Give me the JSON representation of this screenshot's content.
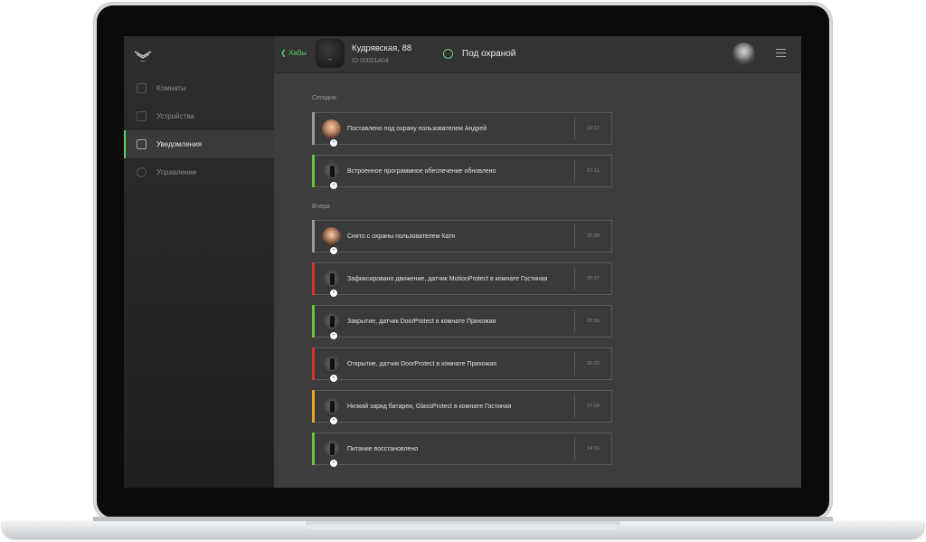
{
  "sidebar": {
    "items": [
      {
        "label": "Комнаты",
        "icon": "rooms-icon",
        "active": false
      },
      {
        "label": "Устройства",
        "icon": "devices-icon",
        "active": false
      },
      {
        "label": "Уведомления",
        "icon": "notifications-icon",
        "active": true
      },
      {
        "label": "Управление",
        "icon": "control-icon",
        "active": false
      }
    ]
  },
  "header": {
    "back_label": "Хабы",
    "hub_name": "Кудрявская, 88",
    "hub_id": "ID 00001A04",
    "status": "Под охраной"
  },
  "sections": {
    "today": "Сегодня",
    "yesterday": "Вчера"
  },
  "events": [
    {
      "text": "Поставлено под охрану пользователем Андрей",
      "time": "10:17",
      "accent": "#9a9a9a",
      "icon": "user-avatar-icon"
    },
    {
      "text": "Встроенное программное обеспечение обновлено",
      "time": "07:11",
      "accent": "#6ac43c",
      "icon": "hub-update-icon"
    },
    {
      "text": "Снято с охраны пользователем Катя",
      "time": "20:28",
      "accent": "#9a9a9a",
      "icon": "user-avatar-icon"
    },
    {
      "text": "Зафиксировано движение, датчик MotionProtect в комнате Гостиная",
      "time": "20:27",
      "accent": "#d8342c",
      "icon": "motion-sensor-icon"
    },
    {
      "text": "Закрытие, датчик DoorProtect в комнате Прихожая",
      "time": "20:26",
      "accent": "#6ac43c",
      "icon": "door-sensor-icon"
    },
    {
      "text": "Открытие, датчик DoorProtect в комнате Прихожая",
      "time": "20:26",
      "accent": "#d8342c",
      "icon": "door-sensor-icon"
    },
    {
      "text": "Низкий заряд батареи, GlassProtect в комнате Гостиная",
      "time": "17:04",
      "accent": "#e8a52c",
      "icon": "glass-sensor-icon"
    },
    {
      "text": "Питание восстановлено",
      "time": "14:16",
      "accent": "#6ac43c",
      "icon": "power-restored-icon"
    }
  ],
  "colors": {
    "accent_green": "#5fd068",
    "background": "#3d3d3d"
  }
}
